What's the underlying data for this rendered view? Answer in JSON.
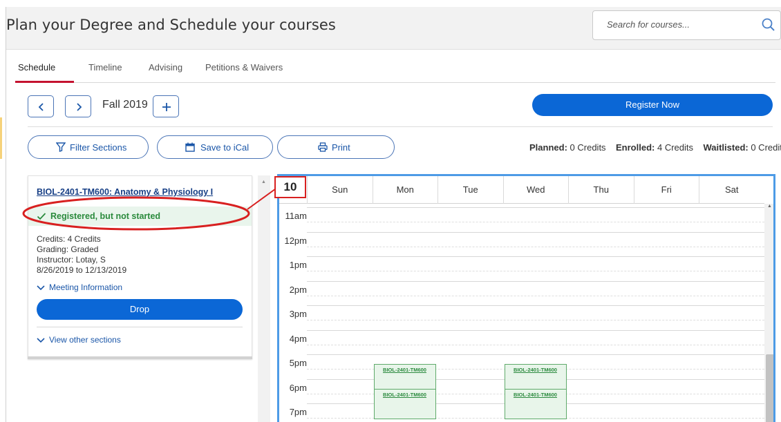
{
  "header": {
    "title": "Plan your Degree and Schedule your courses",
    "search_placeholder": "Search for courses..."
  },
  "tabs": [
    {
      "label": "Schedule",
      "active": true
    },
    {
      "label": "Timeline",
      "active": false
    },
    {
      "label": "Advising",
      "active": false
    },
    {
      "label": "Petitions & Waivers",
      "active": false
    }
  ],
  "term": {
    "label": "Fall 2019",
    "prev_icon": "chevron-left-icon",
    "next_icon": "chevron-right-icon",
    "add_icon": "plus-icon"
  },
  "actions": {
    "register": "Register Now",
    "filter": "Filter Sections",
    "ical": "Save to iCal",
    "print": "Print"
  },
  "credits": {
    "planned_label": "Planned:",
    "planned_value": "0 Credits",
    "enrolled_label": "Enrolled:",
    "enrolled_value": "4 Credits",
    "waitlisted_label": "Waitlisted:",
    "waitlisted_value": "0 Credits"
  },
  "course_card": {
    "title": "BIOL-2401-TM600: Anatomy & Physiology I",
    "status": "Registered, but not started",
    "credits": "Credits: 4 Credits",
    "grading": "Grading: Graded",
    "instructor": "Instructor: Lotay, S",
    "dates": "8/26/2019 to 12/13/2019",
    "meeting_info": "Meeting Information",
    "drop": "Drop",
    "other_sections": "View other sections"
  },
  "calendar": {
    "days": [
      "Sun",
      "Mon",
      "Tue",
      "Wed",
      "Thu",
      "Fri",
      "Sat"
    ],
    "times": [
      "11am",
      "12pm",
      "1pm",
      "2pm",
      "3pm",
      "4pm",
      "5pm",
      "6pm",
      "7pm"
    ],
    "events": [
      {
        "label": "BIOL-2401-TM600",
        "day": "Mon",
        "start": "5pm"
      },
      {
        "label": "BIOL-2401-TM600",
        "day": "Wed",
        "start": "5pm"
      },
      {
        "label": "BIOL-2401-TM600",
        "day": "Mon",
        "start": "6pm"
      },
      {
        "label": "BIOL-2401-TM600",
        "day": "Wed",
        "start": "6pm"
      }
    ]
  },
  "annotation": {
    "number": "10",
    "color": "#d82020"
  },
  "colors": {
    "primary": "#0b67d6",
    "success": "#2a8a3c",
    "tab_accent": "#c4122f",
    "calendar_border": "#4d9be6"
  }
}
